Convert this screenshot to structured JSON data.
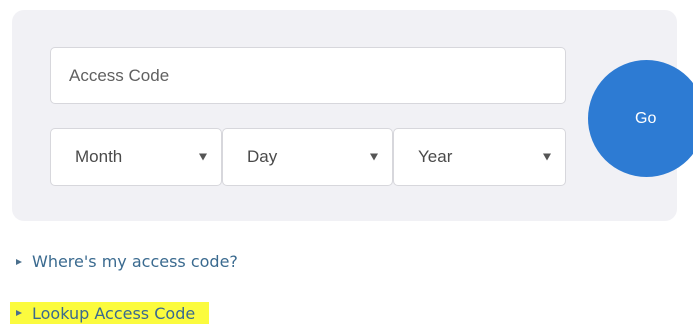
{
  "form": {
    "access_code": {
      "placeholder": "Access Code",
      "value": ""
    },
    "month_select": {
      "selected": "Month",
      "icon": "chevron-down-icon"
    },
    "day_select": {
      "selected": "Day",
      "icon": "chevron-down-icon"
    },
    "year_select": {
      "selected": "Year",
      "icon": "chevron-down-icon"
    },
    "go_button": {
      "label": "Go"
    }
  },
  "links": {
    "where_access_code": {
      "label": "Where's my access code?",
      "icon": "triangle-right-icon"
    },
    "lookup_access_code": {
      "label": "Lookup Access Code",
      "icon": "triangle-right-icon",
      "highlight": "#fbfb3e"
    }
  },
  "colors": {
    "card_background": "#f1f1f5",
    "go_button": "#2d7bd3",
    "link": "#3a6a8f"
  }
}
